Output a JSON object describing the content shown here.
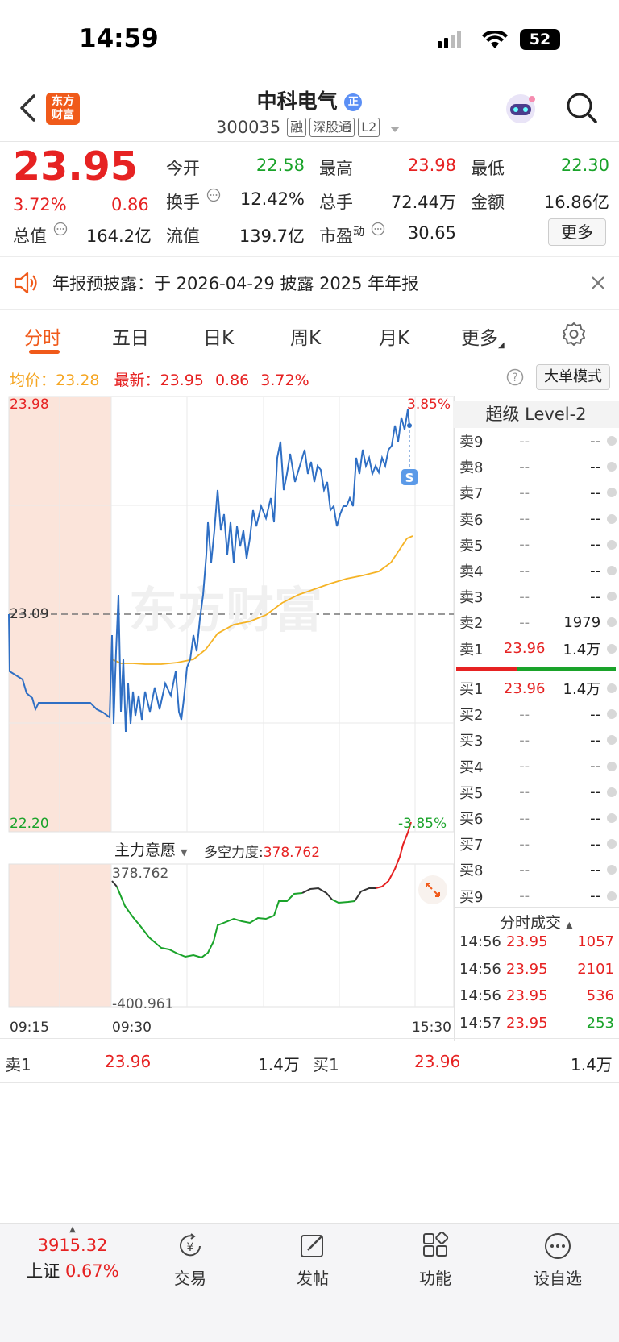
{
  "status_bar": {
    "time": "14:59",
    "battery": "52"
  },
  "header": {
    "logo_text_1": "东方",
    "logo_text_2": "财富",
    "stock_name": "中科电气",
    "stock_badge": "正",
    "stock_code": "300035",
    "tags": [
      "融",
      "深股通",
      "L2"
    ]
  },
  "quote": {
    "price": "23.95",
    "change_pct": "3.72%",
    "change_amt": "0.86",
    "open_label": "今开",
    "open_val": "22.58",
    "high_label": "最高",
    "high_val": "23.98",
    "low_label": "最低",
    "low_val": "22.30",
    "turnover_label": "换手",
    "turnover_val": "12.42%",
    "volume_label": "总手",
    "volume_val": "72.44万",
    "amount_label": "金额",
    "amount_val": "16.86亿",
    "mktcap_label": "总值",
    "mktcap_val": "164.2亿",
    "float_label": "流值",
    "float_val": "139.7亿",
    "pe_label": "市盈",
    "pe_sup": "动",
    "pe_val": "30.65",
    "more_label": "更多"
  },
  "notice": {
    "text": "年报预披露：于 2026-04-29 披露 2025 年年报"
  },
  "tabs": [
    "分时",
    "五日",
    "日K",
    "周K",
    "月K",
    "更多"
  ],
  "infoline": {
    "avg_label": "均价：",
    "avg_val": "23.28",
    "latest_label": "最新：",
    "latest_val": "23.95",
    "latest_chg": "0.86",
    "latest_pct": "3.72%",
    "bigorder_label": "大单模式"
  },
  "chart": {
    "y_top": "23.98",
    "y_mid": "23.09",
    "y_bottom": "22.20",
    "pct_top": "3.85%",
    "pct_bottom": "-3.85%",
    "watermark": "东方财富",
    "s_marker": "S",
    "sub_indicator": "主力意愿",
    "force_label": "多空力度:",
    "force_val": "378.762",
    "sub_top": "378.762",
    "sub_bottom": "-400.961",
    "time_start": "09:15",
    "time_open": "09:30",
    "time_end": "15:30",
    "colors": {
      "price": "#2f6fc4",
      "avg": "#f5b325",
      "force_up": "#e62222",
      "force_down": "#1aa32a",
      "force_flat": "#333333"
    }
  },
  "level2": {
    "title": "超级 Level-2",
    "asks": [
      {
        "label": "卖9",
        "price": "--",
        "vol": "--"
      },
      {
        "label": "卖8",
        "price": "--",
        "vol": "--"
      },
      {
        "label": "卖7",
        "price": "--",
        "vol": "--"
      },
      {
        "label": "卖6",
        "price": "--",
        "vol": "--"
      },
      {
        "label": "卖5",
        "price": "--",
        "vol": "--"
      },
      {
        "label": "卖4",
        "price": "--",
        "vol": "--"
      },
      {
        "label": "卖3",
        "price": "--",
        "vol": "--"
      },
      {
        "label": "卖2",
        "price": "--",
        "vol": "1979"
      },
      {
        "label": "卖1",
        "price": "23.96",
        "vol": "1.4万"
      }
    ],
    "bids": [
      {
        "label": "买1",
        "price": "23.96",
        "vol": "1.4万"
      },
      {
        "label": "买2",
        "price": "--",
        "vol": "--"
      },
      {
        "label": "买3",
        "price": "--",
        "vol": "--"
      },
      {
        "label": "买4",
        "price": "--",
        "vol": "--"
      },
      {
        "label": "买5",
        "price": "--",
        "vol": "--"
      },
      {
        "label": "买6",
        "price": "--",
        "vol": "--"
      },
      {
        "label": "买7",
        "price": "--",
        "vol": "--"
      },
      {
        "label": "买8",
        "price": "--",
        "vol": "--"
      },
      {
        "label": "买9",
        "price": "--",
        "vol": "--"
      }
    ],
    "ticks_title": "分时成交",
    "ticks": [
      {
        "time": "14:56",
        "price": "23.95",
        "vol": "1057",
        "side": "up"
      },
      {
        "time": "14:56",
        "price": "23.95",
        "vol": "2101",
        "side": "up"
      },
      {
        "time": "14:56",
        "price": "23.95",
        "vol": "536",
        "side": "up"
      },
      {
        "time": "14:57",
        "price": "23.95",
        "vol": "253",
        "side": "down"
      }
    ]
  },
  "bottom_quote": {
    "ask_label": "卖1",
    "ask_price": "23.96",
    "ask_vol": "1.4万",
    "bid_label": "买1",
    "bid_price": "23.96",
    "bid_vol": "1.4万"
  },
  "bottom_nav": {
    "index_val": "3915.32",
    "index_name": "上证",
    "index_pct": "0.67%",
    "items": [
      "交易",
      "发帖",
      "功能",
      "设自选"
    ]
  }
}
